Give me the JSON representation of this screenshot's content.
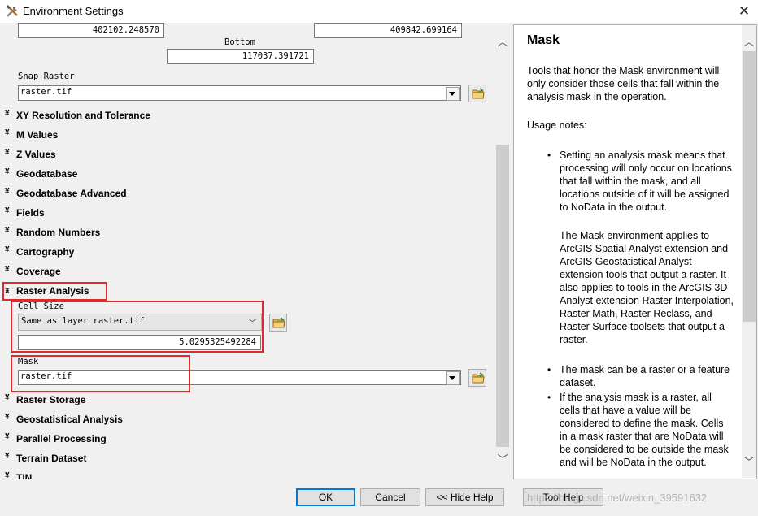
{
  "window": {
    "title": "Environment Settings",
    "close_glyph": "✕"
  },
  "extent": {
    "left_value": "402102.248570",
    "right_value": "409842.699164",
    "bottom_label": "Bottom",
    "bottom_value": "117037.391721"
  },
  "snap_raster": {
    "label": "Snap Raster",
    "value": "raster.tif"
  },
  "sections_top": [
    {
      "label": "XY Resolution and Tolerance"
    },
    {
      "label": "M Values"
    },
    {
      "label": "Z Values"
    },
    {
      "label": "Geodatabase"
    },
    {
      "label": "Geodatabase Advanced"
    },
    {
      "label": "Fields"
    },
    {
      "label": "Random Numbers"
    },
    {
      "label": "Cartography"
    },
    {
      "label": "Coverage"
    }
  ],
  "raster_analysis": {
    "label": "Raster Analysis",
    "cell_size_label": "Cell Size",
    "cell_size_option": "Same as layer raster.tif",
    "cell_size_value": "5.0295325492284",
    "mask_label": "Mask",
    "mask_value": "raster.tif"
  },
  "sections_bottom": [
    {
      "label": "Raster Storage"
    },
    {
      "label": "Geostatistical Analysis"
    },
    {
      "label": "Parallel Processing"
    },
    {
      "label": "Terrain Dataset"
    },
    {
      "label": "TIN"
    }
  ],
  "help": {
    "title": "Mask",
    "intro": "Tools that honor the Mask environment will only consider those cells that fall within the analysis mask in the operation.",
    "usage_heading": "Usage notes:",
    "bullet1": "Setting an analysis mask means that processing will only occur on locations that fall within the mask, and all locations outside of it will be assigned to NoData in the output.",
    "bullet1_para": "The Mask environment applies to ArcGIS Spatial Analyst extension and ArcGIS Geostatistical Analyst extension tools that output a raster. It also applies to tools in the ArcGIS 3D Analyst extension Raster Interpolation, Raster Math, Raster Reclass, and Raster Surface toolsets that output a raster.",
    "bullet2": "The mask can be a raster or a feature dataset.",
    "bullet3": "If the analysis mask is a raster, all cells that have a value will be considered to define the mask. Cells in a mask raster that are NoData will be considered to be outside the mask and will be NoData in the output."
  },
  "buttons": {
    "ok": "OK",
    "cancel": "Cancel",
    "hide_help": "<< Hide Help",
    "tool_help": "Tool Help"
  },
  "watermark": "https://blog.csdn.net/weixin_39591632",
  "colors": {
    "highlight_box": "#e0282e",
    "ok_border": "#0078d7"
  }
}
